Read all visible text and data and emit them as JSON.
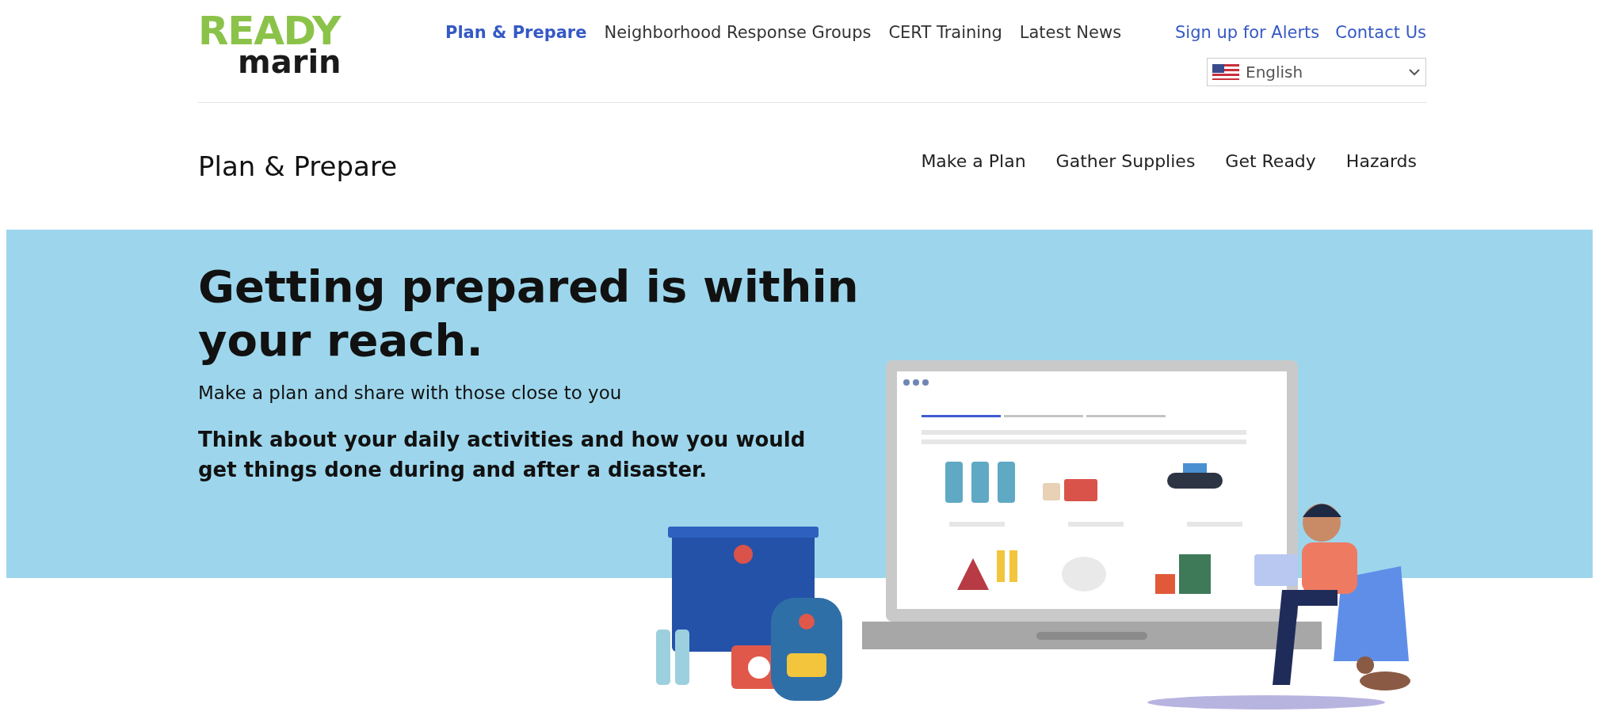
{
  "logo": {
    "line_1": "READY",
    "line_2": "marin"
  },
  "main_nav": [
    {
      "label": "Plan & Prepare",
      "selected": true
    },
    {
      "label": "Neighborhood Response Groups",
      "selected": false
    },
    {
      "label": "CERT Training",
      "selected": false
    },
    {
      "label": "Latest News",
      "selected": false
    }
  ],
  "utility_links": [
    "Sign up for Alerts",
    "Contact Us"
  ],
  "language_select": {
    "value": "English"
  },
  "section": {
    "title": "Plan & Prepare",
    "links": [
      "Make a Plan",
      "Gather Supplies",
      "Get Ready",
      "Hazards"
    ]
  },
  "hero": {
    "heading": "Getting prepared is within your reach.",
    "subtitle": "Make a plan and share with those close to you",
    "text": "Think about your daily activities and how you would get things done during and after a disaster."
  }
}
